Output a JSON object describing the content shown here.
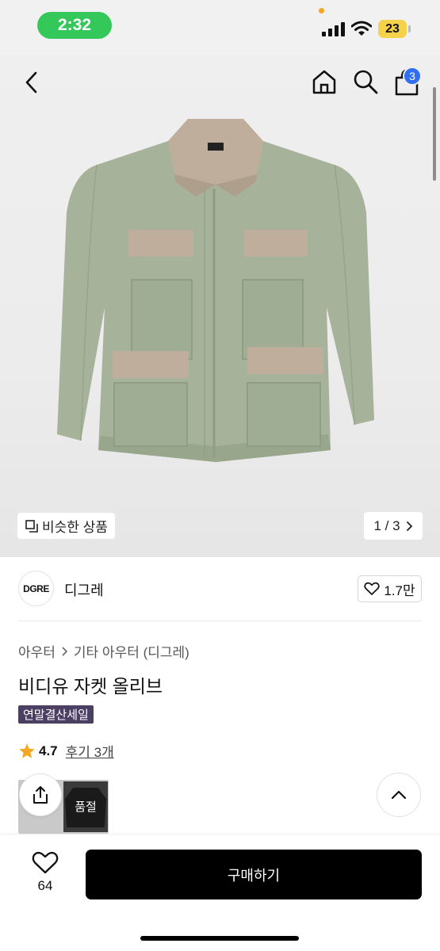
{
  "status_bar": {
    "time": "2:32",
    "battery": "23",
    "icons": [
      "signal-icon",
      "wifi-icon",
      "battery-icon"
    ]
  },
  "header": {
    "icons": [
      "back-icon",
      "home-icon",
      "search-icon",
      "cart-icon"
    ],
    "cart_count": "3"
  },
  "gallery": {
    "similar_label": "비슷한 상품",
    "pager": "1 / 3",
    "image": "olive-field-jacket-photo"
  },
  "brand": {
    "logo_text": "DGRE",
    "name": "디그레",
    "likes": "1.7만"
  },
  "product": {
    "breadcrumb": [
      "아우터",
      "기타 아우터 (디그레)"
    ],
    "title": "비디유 자켓 올리브",
    "badge": "연말결산세일",
    "rating": "4.7",
    "reviews": "후기 3개",
    "soldout_label": "품절"
  },
  "bottom_bar": {
    "wish_count": "64",
    "buy_label": "구매하기"
  },
  "colors": {
    "accent_blue": "#2f6ff0",
    "badge_purple": "#4b3f63",
    "star": "#f5a623",
    "buy_button": "#000000",
    "status_green": "#34c759"
  }
}
